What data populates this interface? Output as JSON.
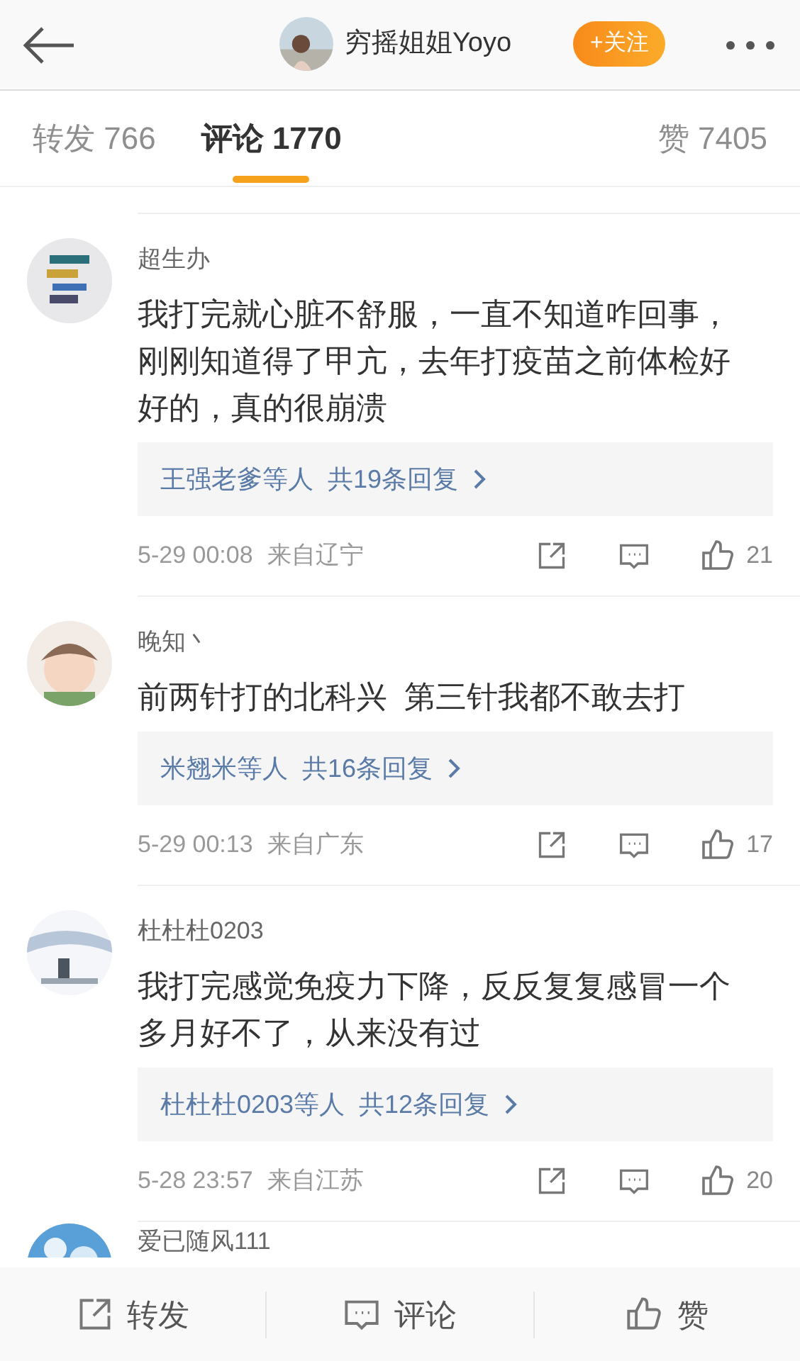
{
  "header": {
    "author": "穷摇姐姐Yoyo",
    "follow": "+关注"
  },
  "tabs": [
    {
      "label": "转发",
      "count": "766",
      "selected": false
    },
    {
      "label": "评论",
      "count": "1770",
      "selected": true
    },
    {
      "label": "赞",
      "count": "7405",
      "selected": false
    }
  ],
  "comments": [
    {
      "name": "超生办",
      "text": "我打完就心脏不舒服，一直不知道咋回事，刚刚知道得了甲亢，去年打疫苗之前体检好好的，真的很崩溃",
      "replies_by": "王强老爹等人",
      "replies_count": "共19条回复",
      "time": "5-29 00:08",
      "location": "来自辽宁",
      "likes": "21"
    },
    {
      "name": "晚知丶",
      "text": "前两针打的北科兴  第三针我都不敢去打",
      "replies_by": "米翘米等人",
      "replies_count": "共16条回复",
      "time": "5-29 00:13",
      "location": "来自广东",
      "likes": "17"
    },
    {
      "name": "杜杜杜0203",
      "text": "我打完感觉免疫力下降，反反复复感冒一个多月好不了，从来没有过",
      "replies_by": "杜杜杜0203等人",
      "replies_count": "共12条回复",
      "time": "5-28 23:57",
      "location": "来自江苏",
      "likes": "20"
    },
    {
      "name": "爱已随风111"
    }
  ],
  "bottom_bar": [
    "转发",
    "评论",
    "赞"
  ]
}
